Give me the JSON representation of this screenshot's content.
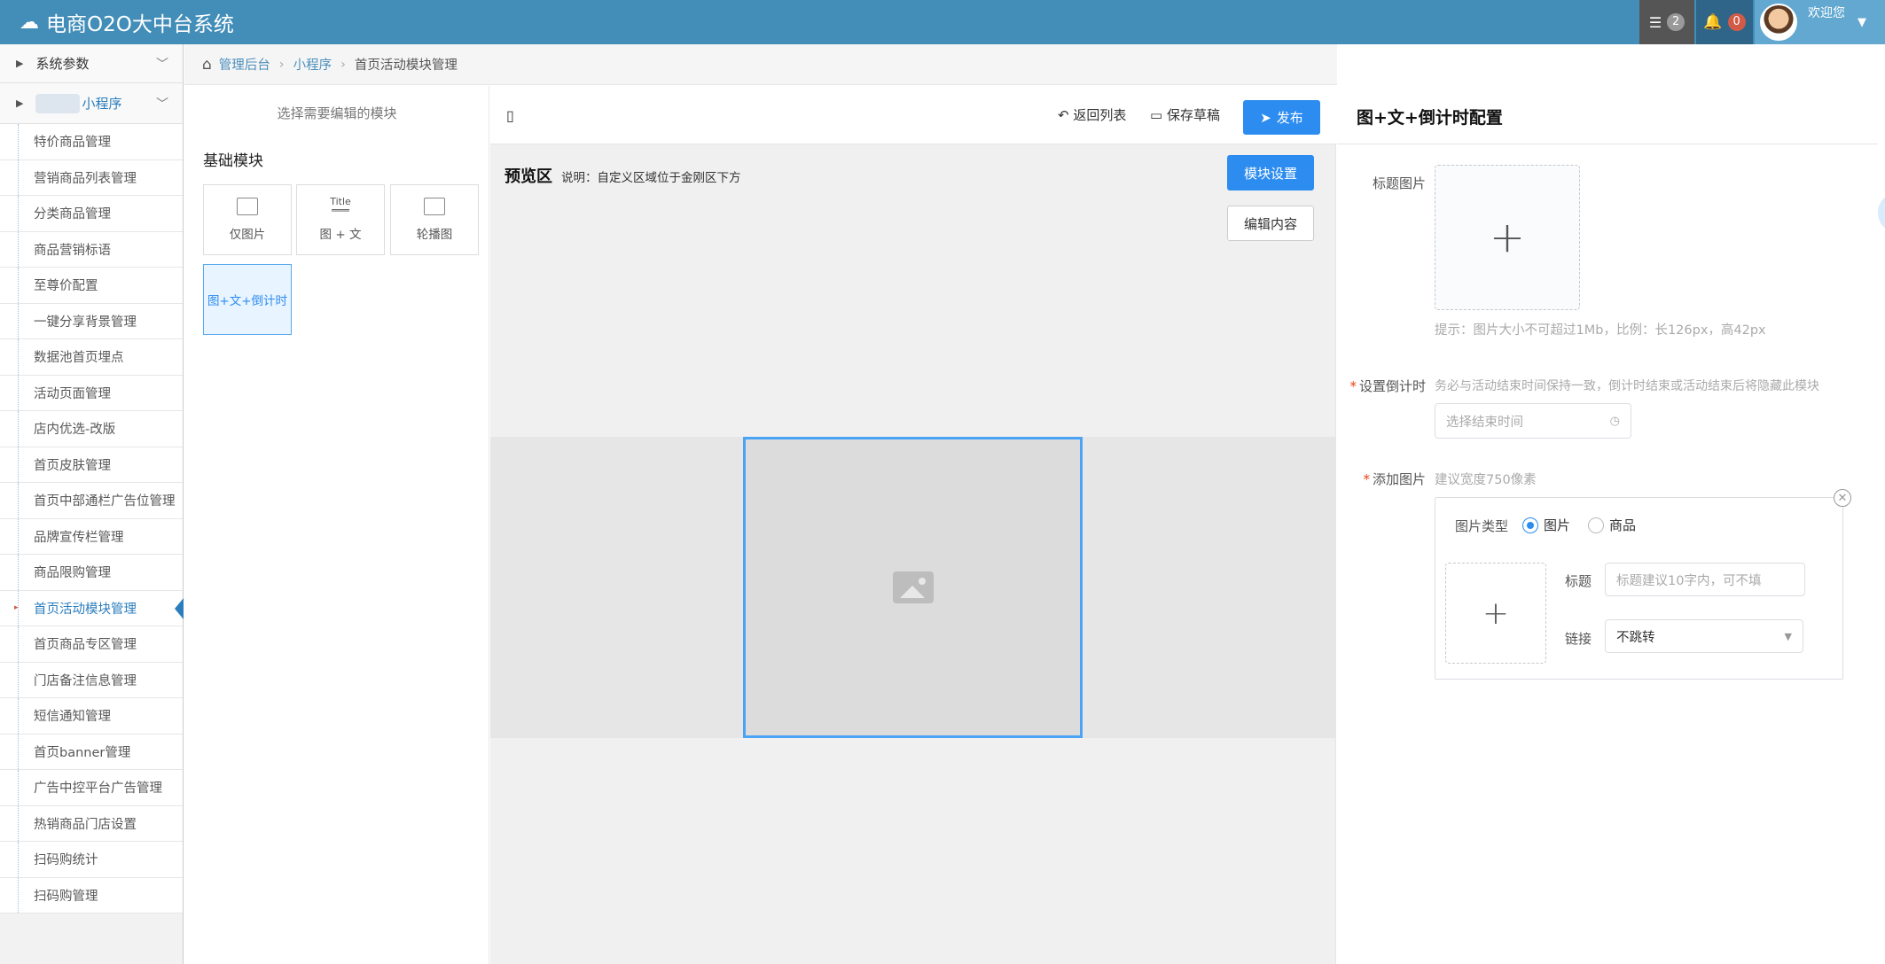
{
  "app": {
    "title": "电商O2O大中台系统",
    "message_count": "2",
    "notification_count": "0",
    "welcome": "欢迎您"
  },
  "sidebar": {
    "group_system": "系统参数",
    "group_miniapp": "小程序",
    "items": [
      "特价商品管理",
      "营销商品列表管理",
      "分类商品管理",
      "商品营销标语",
      "至尊价配置",
      "一键分享背景管理",
      "数据池首页埋点",
      "活动页面管理",
      "店内优选-改版",
      "首页皮肤管理",
      "首页中部通栏广告位管理",
      "品牌宣传栏管理",
      "商品限购管理",
      "首页活动模块管理",
      "首页商品专区管理",
      "门店备注信息管理",
      "短信通知管理",
      "首页banner管理",
      "广告中控平台广告管理",
      "热销商品门店设置",
      "扫码购统计",
      "扫码购管理"
    ],
    "active_index": 13
  },
  "breadcrumb": {
    "root": "管理后台",
    "middle": "小程序",
    "current": "首页活动模块管理"
  },
  "picker": {
    "hint": "选择需要编辑的模块",
    "section_title": "基础模块",
    "modules": {
      "image_only": "仅图片",
      "image_text": "图 + 文",
      "carousel": "轮播图",
      "countdown": "图+文+倒计时",
      "title_icon_text": "Title"
    }
  },
  "preview": {
    "back_to_list": "返回列表",
    "save_draft": "保存草稿",
    "publish": "发布",
    "title": "预览区",
    "note": "说明：自定义区域位于金刚区下方",
    "module_settings": "模块设置",
    "edit_content": "编辑内容"
  },
  "config": {
    "title": "图+文+倒计时配置",
    "title_image_label": "标题图片",
    "title_image_hint": "提示：图片大小不可超过1Mb，比例：长126px，高42px",
    "countdown_label": "设置倒计时",
    "countdown_hint": "务必与活动结束时间保持一致，倒计时结束或活动结束后将隐藏此模块",
    "countdown_placeholder": "选择结束时间",
    "add_image_label": "添加图片",
    "add_image_hint": "建议宽度750像素",
    "image_type_label": "图片类型",
    "type_options": [
      "图片",
      "商品"
    ],
    "type_selected": "图片",
    "item_title_label": "标题",
    "item_title_placeholder": "标题建议10字内，可不填",
    "link_label": "链接",
    "link_value": "不跳转"
  },
  "colors": {
    "topbar": "#438eb9",
    "primary_button": "#2d8cf0",
    "active_link": "#2b7dbc",
    "badge_red": "#d15b47"
  }
}
